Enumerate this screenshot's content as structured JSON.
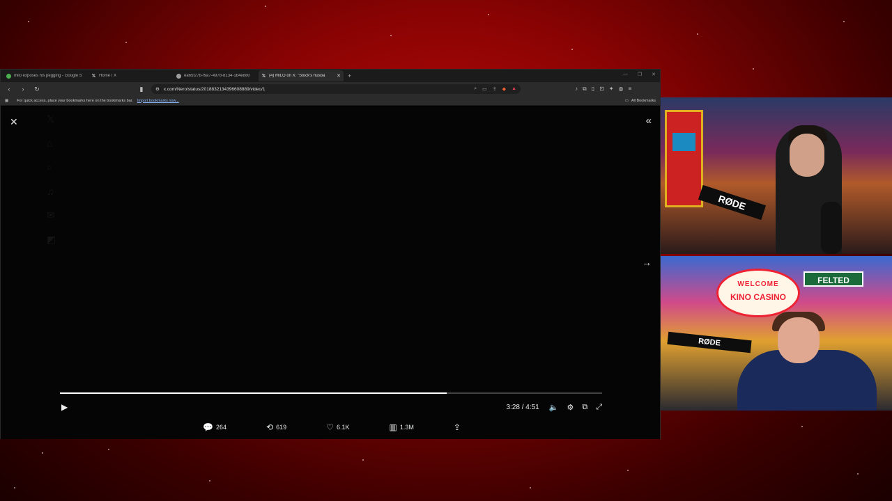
{
  "browser": {
    "tabs": [
      {
        "label": "milo exposes his pegging - Google S",
        "icon": "google-icon",
        "active": false
      },
      {
        "label": "Home / X",
        "icon": "x-logo-icon",
        "active": false
      },
      {
        "label": "ea65f27b-f9a7-4978-8134-1b4e880",
        "icon": "globe-icon",
        "active": false
      },
      {
        "label": "(4) MILO on X: \"Stock's husba",
        "icon": "x-logo-icon",
        "active": true
      }
    ],
    "new_tab": "+",
    "url": "x.com/Nero/status/2018832134396608889/video/1",
    "bookmarks_prompt": "For quick access, place your bookmarks here on the bookmarks bar.",
    "import_link": "Import bookmarks now...",
    "all_bookmarks": "All Bookmarks"
  },
  "player": {
    "progress": 0.714,
    "time": "3:28 / 4:51"
  },
  "actions": {
    "replies": "264",
    "reposts": "619",
    "likes": "6.1K",
    "views": "1.3M"
  },
  "overlay": {
    "mic_brand": "RØDE",
    "sign_welcome": "WELCOME",
    "sign_name": "KINO CASINO",
    "street_sign": "FELTED"
  }
}
